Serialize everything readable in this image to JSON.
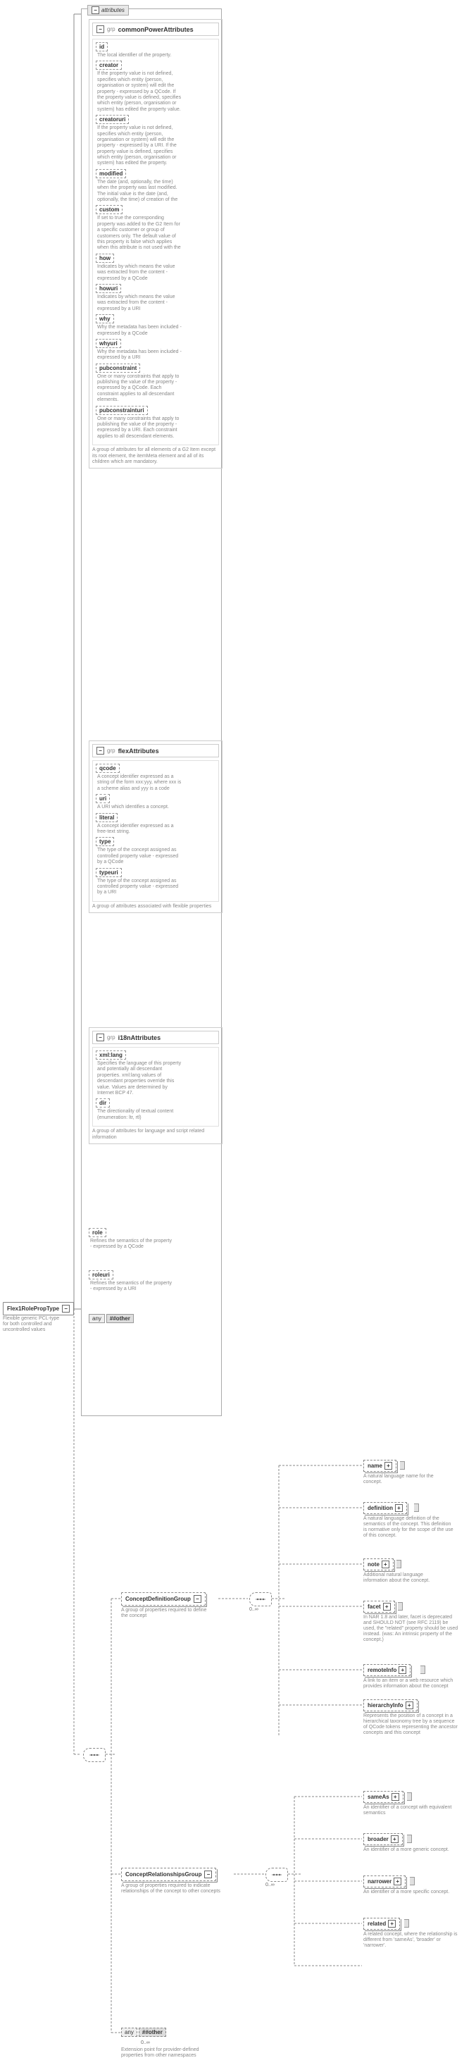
{
  "root": {
    "name": "Flex1RolePropType",
    "description": "Flexible generic PCL-type for both controlled and uncontrolled values"
  },
  "attributes_label": "attributes",
  "groups": {
    "commonPower": {
      "title": "commonPowerAttributes",
      "prefix": "grp",
      "footer": "A group of attributes for all elements of a G2 Item except its root element, the itemMeta element and all of its children which are mandatory.",
      "attrs": [
        {
          "name": "id",
          "desc": "The local identifier of the property."
        },
        {
          "name": "creator",
          "desc": "If the property value is not defined, specifies which entity (person, organisation or system) will edit the property - expressed by a QCode. If the property value is defined, specifies which entity (person, organisation or system) has edited the property value."
        },
        {
          "name": "creatoruri",
          "desc": "If the property value is not defined, specifies which entity (person, organisation or system) will edit the property - expressed by a URI. If the property value is defined, specifies which entity (person, organisation or system) has edited the property."
        },
        {
          "name": "modified",
          "desc": "The date (and, optionally, the time) when the property was last modified. The initial value is the date (and, optionally, the time) of creation of the"
        },
        {
          "name": "custom",
          "desc": "If set to true the corresponding property was added to the G2 Item for a specific customer or group of customers only. The default value of this property is false which applies when this attribute is not used with the"
        },
        {
          "name": "how",
          "desc": "Indicates by which means the value was extracted from the content - expressed by a QCode"
        },
        {
          "name": "howuri",
          "desc": "Indicates by which means the value was extracted from the content - expressed by a URI"
        },
        {
          "name": "why",
          "desc": "Why the metadata has been included - expressed by a QCode"
        },
        {
          "name": "whyuri",
          "desc": "Why the metadata has been included - expressed by a URI"
        },
        {
          "name": "pubconstraint",
          "desc": "One or many constraints that apply to publishing the value of the property - expressed by a QCode. Each constraint applies to all descendant elements."
        },
        {
          "name": "pubconstrainturi",
          "desc": "One or many constraints that apply to publishing the value of the property - expressed by a URI. Each constraint applies to all descendant elements."
        }
      ]
    },
    "flex": {
      "title": "flexAttributes",
      "prefix": "grp",
      "footer": "A group of attributes associated with flexible properties",
      "attrs": [
        {
          "name": "qcode",
          "desc": "A concept identifier expressed as a string of the form xxx:yyy, where xxx is a scheme alias and yyy is a code"
        },
        {
          "name": "uri",
          "desc": "A URI which identifies a concept."
        },
        {
          "name": "literal",
          "desc": "A concept identifier expressed as a free-text string."
        },
        {
          "name": "type",
          "desc": "The type of the concept assigned as controlled property value - expressed by a QCode"
        },
        {
          "name": "typeuri",
          "desc": "The type of the concept assigned as controlled property value - expressed by a URI"
        }
      ]
    },
    "i18n": {
      "title": "i18nAttributes",
      "prefix": "grp",
      "footer": "A group of attributes for language and script related information",
      "attrs": [
        {
          "name": "xml:lang",
          "desc": "Specifies the language of this property and potentially all descendant properties. xml:lang values of descendant properties override this value. Values are determined by Internet BCP 47."
        },
        {
          "name": "dir",
          "desc": "The directionality of textual content (enumeration: ltr, rtl)"
        }
      ]
    }
  },
  "standalone_attrs": {
    "role": {
      "name": "role",
      "desc": "Refines the semantics of the property - expressed by a QCode"
    },
    "roleuri": {
      "name": "roleuri",
      "desc": "Refines the semantics of the property - expressed by a URI"
    }
  },
  "any_attr": {
    "label": "##other",
    "prefix": "any"
  },
  "model_groups": {
    "cdg": {
      "name": "ConceptDefinitionGroup",
      "desc": "A group of properties required to define the concept"
    },
    "crg": {
      "name": "ConceptRelationshipsGroup",
      "desc": "A group of properties required to indicate relationships of the concept to other concepts"
    }
  },
  "leaves": {
    "name": {
      "name": "name",
      "desc": "A natural language name for the concept."
    },
    "definition": {
      "name": "definition",
      "desc": "A natural language definition of the semantics of the concept. This definition is normative only for the scope of the use of this concept."
    },
    "note": {
      "name": "note",
      "desc": "Additional natural language information about the concept."
    },
    "facet": {
      "name": "facet",
      "desc": "In NAR 1.8 and later, facet is deprecated and SHOULD NOT (see RFC 2119) be used, the \"related\" property should be used instead. (was: An intrinsic property of the concept.)"
    },
    "remoteInfo": {
      "name": "remoteInfo",
      "desc": "A link to an item or a web resource which provides information about the concept"
    },
    "hierarchyInfo": {
      "name": "hierarchyInfo",
      "desc": "Represents the position of a concept in a hierarchical taxonomy tree by a sequence of QCode tokens representing the ancestor concepts and this concept"
    },
    "sameAs": {
      "name": "sameAs",
      "desc": "An identifier of a concept with equivalent semantics"
    },
    "broader": {
      "name": "broader",
      "desc": "An identifier of a more generic concept."
    },
    "narrower": {
      "name": "narrower",
      "desc": "An identifier of a more specific concept."
    },
    "related": {
      "name": "related",
      "desc": "A related concept, where the relationship is different from 'sameAs', 'broader' or 'narrower'."
    }
  },
  "any_elem": {
    "label": "##other",
    "prefix": "any",
    "range": "0..∞",
    "desc": "Extension point for provider-defined properties from other namespaces"
  },
  "occ_range": "0..∞"
}
